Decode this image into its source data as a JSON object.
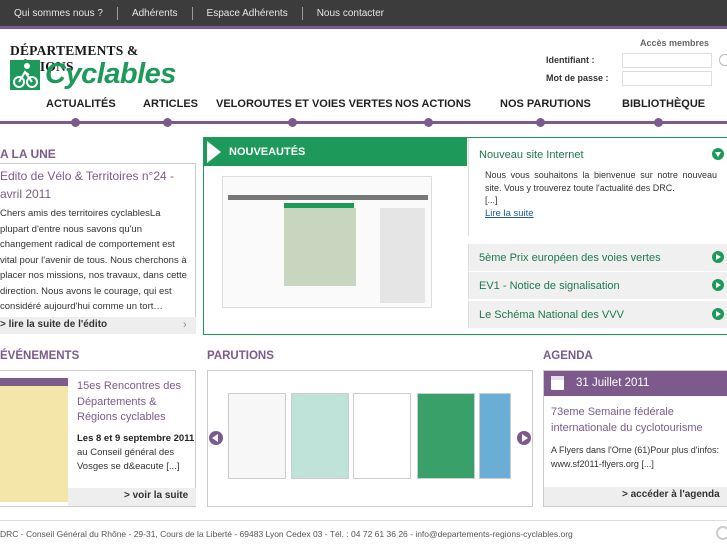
{
  "topnav": [
    "Qui sommes nous ?",
    "Adhérents",
    "Espace Adhérents",
    "Nous contacter"
  ],
  "logo": {
    "line1": "DÉPARTEMENTS & RÉGIONS",
    "line2": "Cyclables"
  },
  "members": {
    "title": "Accès membres",
    "login_label": "Identifiant :",
    "password_label": "Mot de passe :"
  },
  "mainnav": [
    "ACTUALITÉS",
    "ARTICLES",
    "VELOROUTES ET VOIES VERTES",
    "NOS ACTIONS",
    "NOS PARUTIONS",
    "BIBLIOTHÈQUE"
  ],
  "alaune": {
    "title": "A LA UNE",
    "edito_title": "Edito de Vélo & Territoires n°24 - avril 2011",
    "edito_text": "Chers amis des territoires cyclablesLa plupart d'entre nous savons qu'un changement radical de comportement est vital pour l'avenir de tous. Nous cherchons à placer nos missions, nos travaux, dans cette direction. Nous avons le courage, qui est considéré aujourd'hui comme un tort…davoir raison trop tôt !L'actualité drama [...]",
    "read_more": "> lire la suite de l'édito"
  },
  "nouveautes": {
    "title": "NOUVEAUTÉS",
    "first": {
      "title": "Nouveau site Internet",
      "text": "Nous vous souhaitons la bienvenue sur notre nouveau site. Vous y trouverez toute l'actualité des DRC.",
      "ellipsis": "[...]",
      "link": "Lire la suite"
    },
    "items": [
      "5ème Prix européen des voies vertes",
      "EV1 - Notice de signalisation",
      "Le Schéma National des VVV"
    ]
  },
  "events": {
    "title": "ÉVÉNEMENTS",
    "event_title": "15es Rencontres des Départements & Régions cyclables",
    "date": "Les 8 et 9 septembre 2011",
    "text": "au Conseil général des Vosges se d&eacute [...]",
    "more": "> voir la suite"
  },
  "parutions": {
    "title": "PARUTIONS"
  },
  "agenda": {
    "title": "AGENDA",
    "date": "31 Juillet 2011",
    "event_title": "73eme Semaine fédérale internationale du cyclotourisme",
    "text": "A Flyers dans l'Orne (61)Pour plus d'infos: www.sf2011-flyers.org   [...]",
    "more": "> accéder à l'agenda"
  },
  "footer": "DRC - Conseil Général du Rhône - 29-31, Cours de la Liberté - 69483 Lyon Cedex 03 - Tél. : 04 72 61 36 26 - info@departements-regions-cyclables.org"
}
